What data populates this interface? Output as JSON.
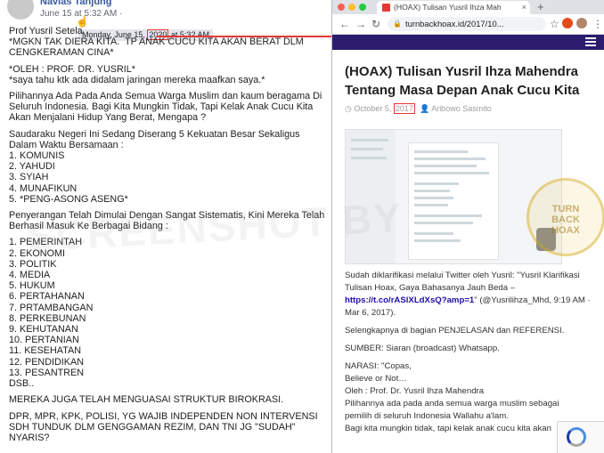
{
  "post": {
    "author": "Navias Tanjung",
    "date": "June 15 at 5:32 AM",
    "globe": "·",
    "tooltip_prefix": "Monday, June 15, ",
    "tooltip_year": "2020",
    "tooltip_suffix": " at 5:32 AM",
    "lines": [
      "Prof Yusril Setela",
      "*MGKN TAK DIERA KITA.  TP ANAK CUCU KITA AKAN BERAT DLM CENGKERAMAN CINA*",
      "",
      "*OLEH : PROF. DR. YUSRIL*",
      "*saya tahu ktk ada didalam jaringan mereka maafkan saya.*",
      "",
      "Pilihannya Ada Pada Anda Semua Warga Muslim dan kaum beragama Di Seluruh Indonesia. Bagi Kita Mungkin Tidak, Tapi Kelak Anak Cucu Kita Akan Menjalani Hidup Yang Berat, Mengapa ?",
      "",
      "Saudaraku Negeri Ini Sedang Diserang 5 Kekuatan Besar Sekaligus Dalam Waktu Bersamaan :",
      "1. KOMUNIS",
      "2. YAHUDI",
      "3. SYIAH",
      "4. MUNAFIKUN",
      "5. *PENG-ASONG ASENG*",
      "",
      "Penyerangan Telah Dimulai Dengan Sangat Sistematis, Kini Mereka Telah Berhasil Masuk Ke Berbagai Bidang :",
      "",
      "1. PEMERINTAH",
      "2. EKONOMI",
      "3. POLITIK",
      "4. MEDIA",
      "5. HUKUM",
      "6. PERTAHANAN",
      "7. PRTAMBANGAN",
      "8. PERKEBUNAN",
      "9. KEHUTANAN",
      "10. PERTANIAN",
      "11. KESEHATAN",
      "12. PENDIDIKAN",
      "13. PESANTREN",
      "DSB..",
      "",
      "MEREKA JUGA TELAH MENGUASAI STRUKTUR BIROKRASI.",
      "",
      "DPR, MPR, KPK, POLISI, YG WAJIB INDEPENDEN NON INTERVENSI SDH TUNDUK DLM GENGGAMAN REZIM, DAN TNI JG \"SUDAH\" NYARIS?"
    ]
  },
  "browser": {
    "tab_title": "(HOAX) Tulisan Yusril Ihza Mah",
    "tab_close": "×",
    "new_tab": "+",
    "back": "←",
    "forward": "→",
    "reload": "↻",
    "lock": "🔒",
    "url": "turnbackhoax.id/2017/10...",
    "star": "☆",
    "menu": "⋮",
    "traffic_colors": [
      "#ff5f57",
      "#febc2e",
      "#28c840"
    ]
  },
  "article": {
    "title": "(HOAX) Tulisan Yusril Ihza Mahendra Tentang Masa Depan Anak Cucu Kita",
    "meta_date_prefix": "October 5, ",
    "meta_year": "2017",
    "meta_author": "Aribowo Sasmito",
    "paragraphs": [
      "Sudah diklarifikasi melalui Twitter oleh Yusril: \"Yusril Klarifikasi Tulisan Hoax, Gaya Bahasanya Jauh Beda – ",
      "https://t.co/rASlXLdXsQ?amp=1",
      "\" (@Yusrilihza_Mhd, 9:19 AM · Mar 6, 2017)."
    ],
    "p2": "Selengkapnya di bagian PENJELASAN dan REFERENSI.",
    "p3": "SUMBER: Siaran (broadcast) Whatsapp.",
    "p4_lines": [
      "NARASI: \"Copas,",
      "Believe or Not…",
      "Oleh : Prof. Dr. Yusril Ihza Mahendra",
      "Pilihannya ada pada anda semua warga muslim sebagai",
      "pemilih di seluruh Indonesia Wallahu a'lam.",
      "Bagi kita mungkin tidak, tapi kelak anak cucu kita akan"
    ]
  },
  "stamp": {
    "text": "TURN BACK HOAX"
  },
  "watermark": "SCREENSHOT BY",
  "colors": {
    "highlight": "#e53935",
    "fb_link": "#385898",
    "site_header": "#2b1c6e"
  }
}
